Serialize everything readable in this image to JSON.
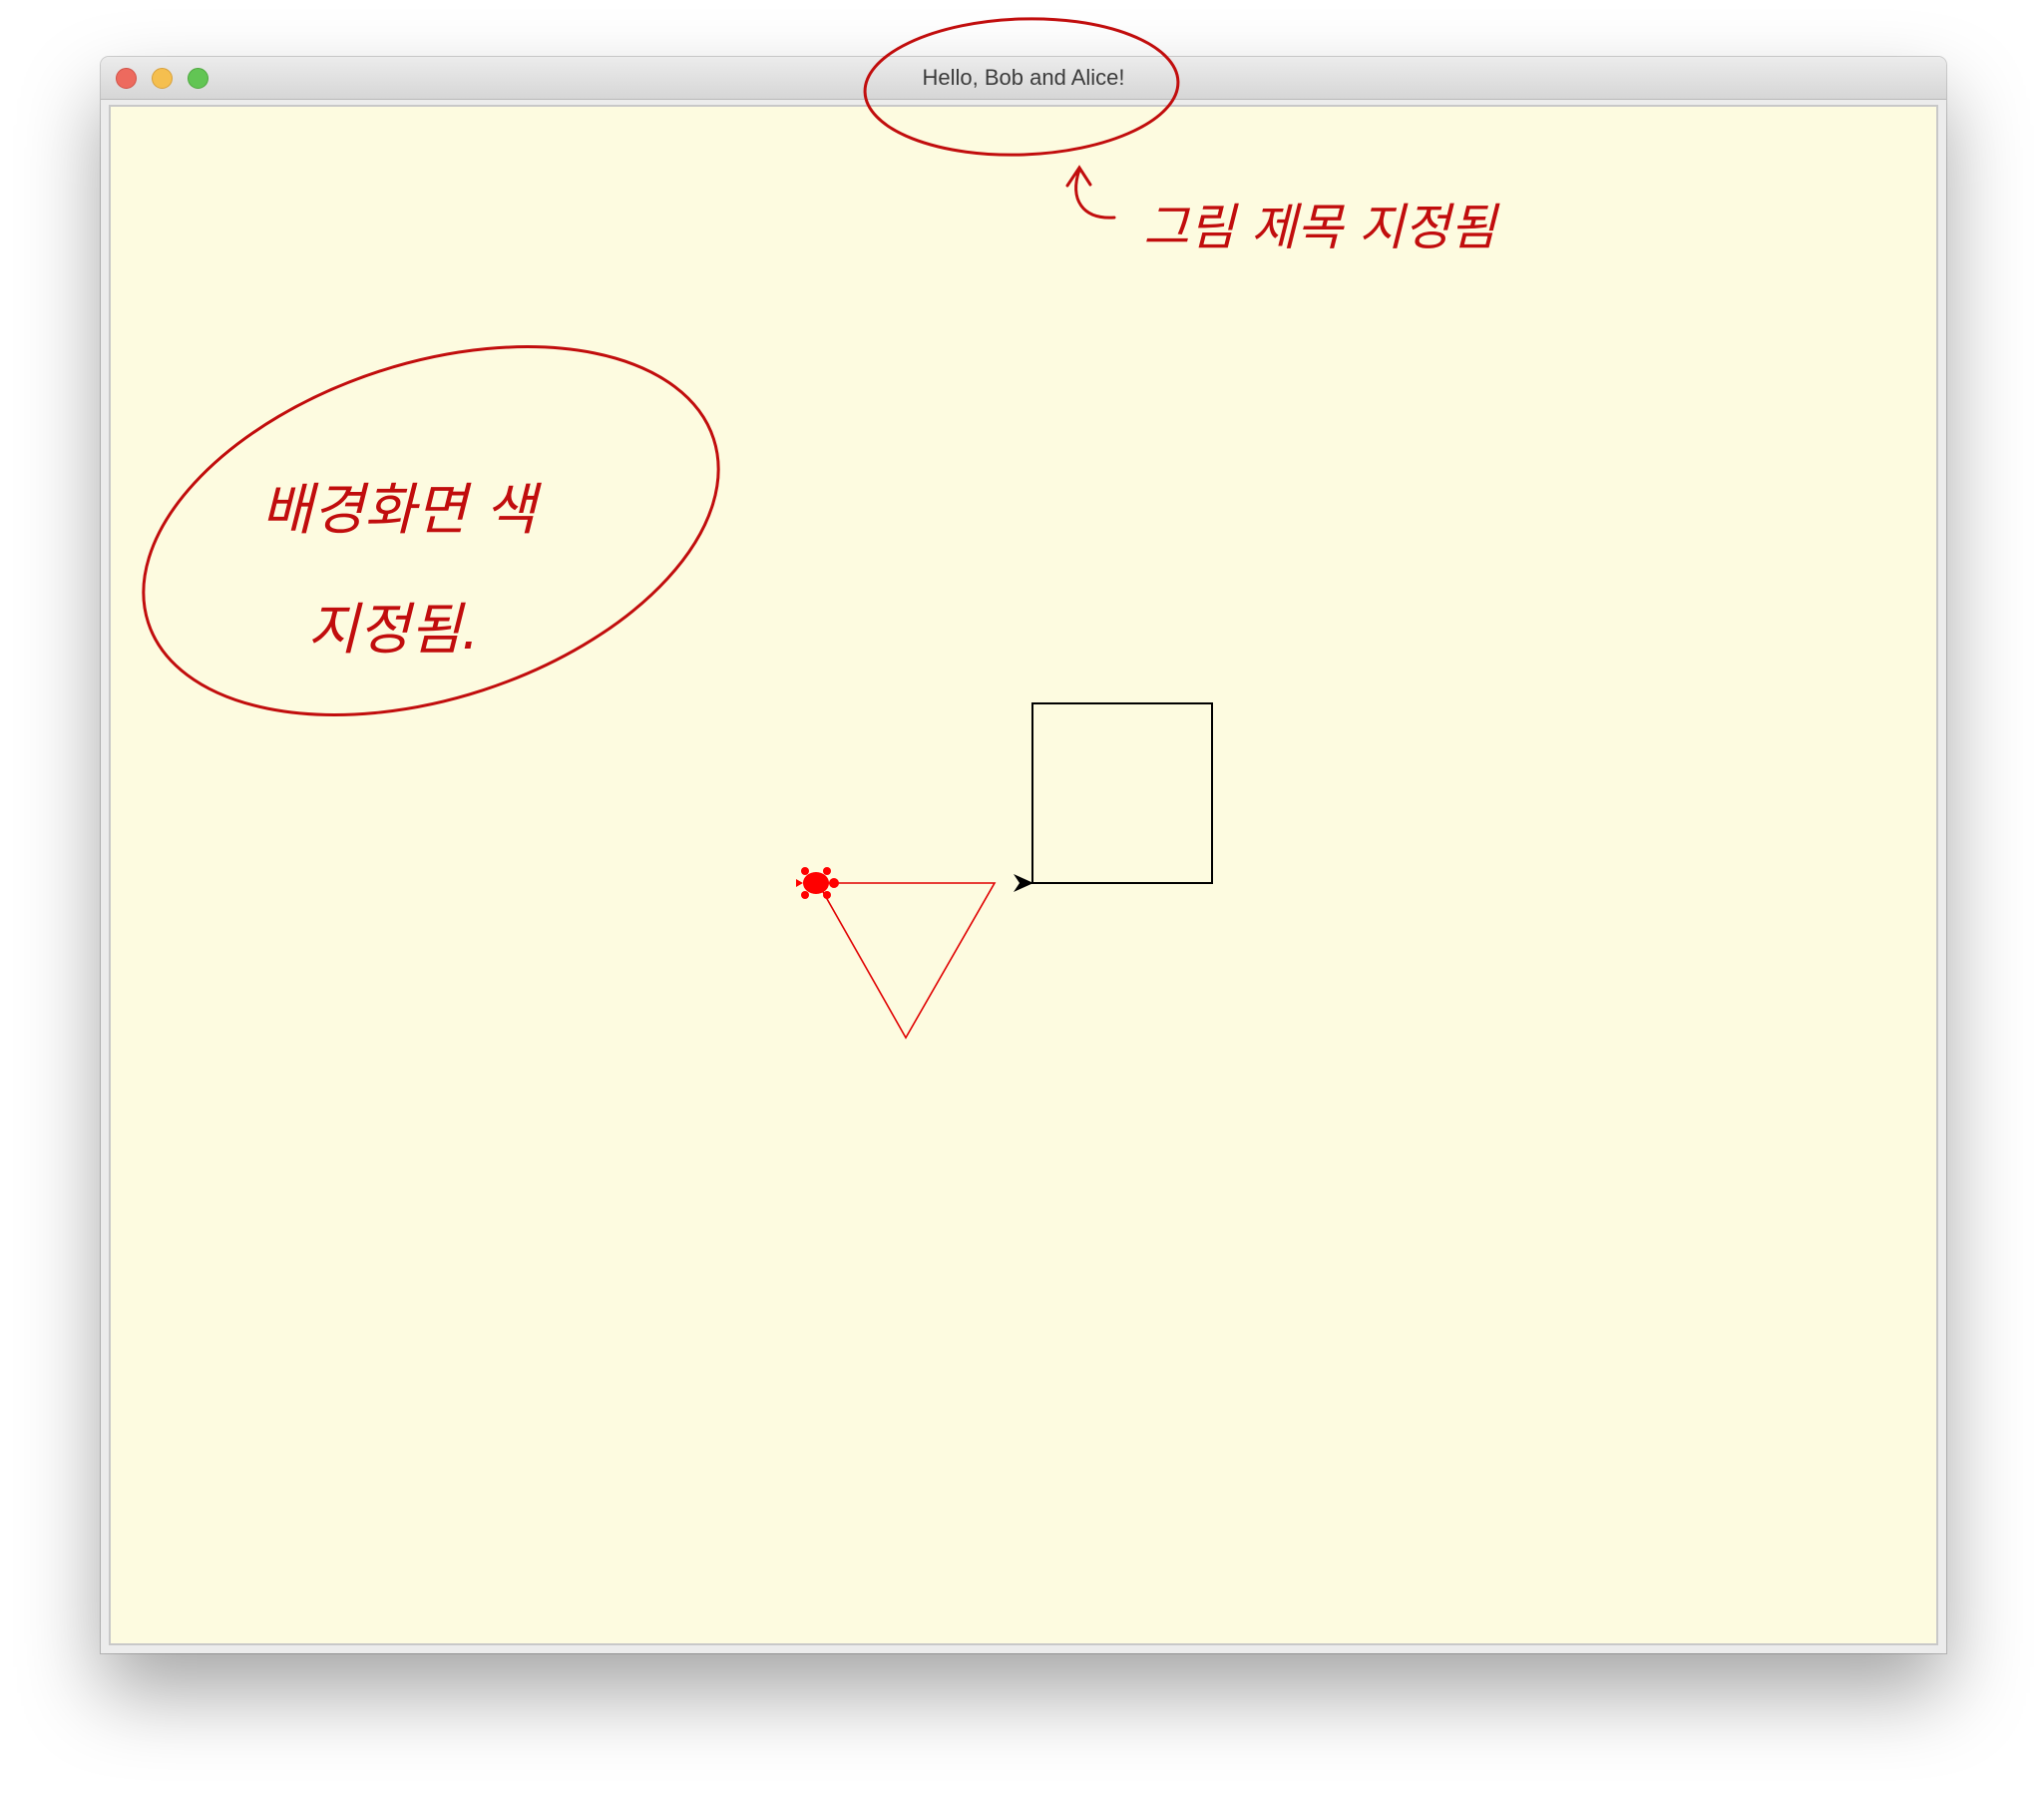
{
  "window": {
    "title": "Hello, Bob and Alice!",
    "canvas_background": "#fdfbe0"
  },
  "titlebar": {
    "controls": [
      "close-button",
      "minimize-button",
      "zoom-button"
    ]
  },
  "drawing": {
    "square_color": "#000000",
    "triangle_color": "#e00000",
    "turtle_red_color": "#ff0000",
    "turtle_black_color": "#000000"
  },
  "annotations": {
    "color": "#c10d0d",
    "title_note": "그림 제목 지정됨",
    "background_note_line1": "배경화면 색",
    "background_note_line2": "지정됨."
  }
}
